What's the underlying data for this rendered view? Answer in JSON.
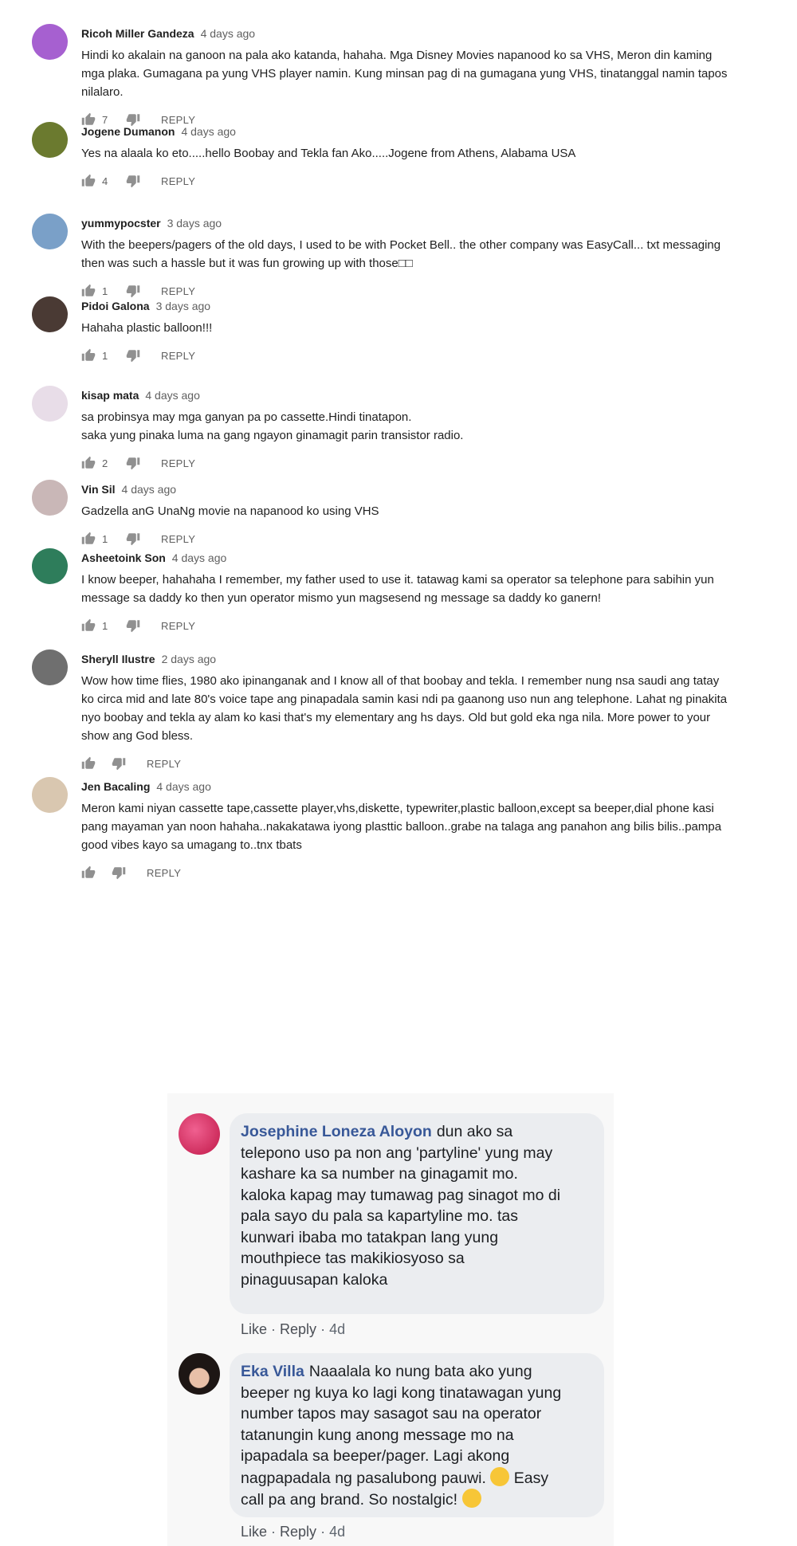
{
  "yt_comments": [
    {
      "author": "Ricoh Miller Gandeza",
      "time": "4 days ago",
      "lines": [
        "Hindi ko akalain na ganoon na pala ako katanda, hahaha. Mga Disney Movies napanood ko sa VHS, Meron din kaming",
        "mga plaka. Gumagana pa yung VHS player namin. Kung minsan  pag di na gumagana yung VHS, tinatanggal namin  tapos",
        "nilalaro."
      ],
      "likes": "7",
      "reply": "REPLY",
      "avatar_color": "#a660d0",
      "avatar_letter": ""
    },
    {
      "author": "Jogene Dumanon",
      "time": "4 days ago",
      "lines": [
        "Yes na alaala ko eto.....hello Boobay and Tekla fan Ako.....Jogene from Athens, Alabama USA"
      ],
      "likes": "4",
      "reply": "REPLY",
      "avatar_color": "#6b7a2f",
      "avatar_letter": ""
    },
    {
      "author": "yummypocster",
      "time": "3 days ago",
      "lines": [
        "With the beepers/pagers of the old days, I used to be with Pocket Bell.. the other company was EasyCall... txt messaging",
        "then was such a hassle but it was fun growing up with those□□"
      ],
      "likes": "1",
      "reply": "REPLY",
      "avatar_color": "#7aa0c8",
      "avatar_letter": ""
    },
    {
      "author": "Pidoi Galona",
      "time": "3 days ago",
      "lines": [
        "Hahaha plastic balloon!!!"
      ],
      "likes": "1",
      "reply": "REPLY",
      "avatar_color": "#4a3a34",
      "avatar_letter": ""
    },
    {
      "author": "kisap mata",
      "time": "4 days ago",
      "lines": [
        "sa probinsya may mga ganyan pa po cassette.Hindi tinatapon.",
        "saka yung pinaka luma na gang ngayon ginamagit parin transistor radio."
      ],
      "likes": "2",
      "reply": "REPLY",
      "avatar_color": "#e8dde8",
      "avatar_letter": ""
    },
    {
      "author": "Vin Sil",
      "time": "4 days ago",
      "lines": [
        "Gadzella anG UnaNg movie na napanood ko using VHS"
      ],
      "likes": "1",
      "reply": "REPLY",
      "avatar_color": "#c9b7b7",
      "avatar_letter": ""
    },
    {
      "author": "Asheetoink Son",
      "time": "4 days ago",
      "lines": [
        "I know beeper, hahahaha I remember, my father used to use it. tatawag kami sa operator sa telephone para sabihin yun",
        "message sa daddy ko then yun operator mismo yun magsesend ng message sa daddy ko ganern!"
      ],
      "likes": "1",
      "reply": "REPLY",
      "avatar_color": "#2e7d5b",
      "avatar_letter": ""
    },
    {
      "author": "Sheryll Ilustre",
      "time": "2 days ago",
      "lines": [
        "Wow how time flies, 1980 ako ipinanganak and I know all of that boobay and tekla. I remember nung nsa saudi ang tatay",
        "ko circa mid and late 80's voice tape ang pinapadala samin kasi ndi pa gaanong uso nun ang telephone. Lahat ng pinakita",
        "nyo boobay and tekla ay alam ko kasi that's my elementary ang hs days. Old but gold eka nga nila. More power to your",
        "show ang God bless."
      ],
      "likes": "",
      "reply": "REPLY",
      "avatar_color": "#6f6f6f",
      "avatar_letter": ""
    },
    {
      "author": "Jen Bacaling",
      "time": "4 days ago",
      "lines": [
        "Meron kami niyan cassette tape,cassette player,vhs,diskette, typewriter,plastic balloon,except sa beeper,dial phone kasi",
        "pang mayaman yan noon hahaha..nakakatawa iyong plasttic balloon..grabe na talaga ang panahon ang bilis bilis..pampa",
        "good vibes kayo sa umagang to..tnx tbats"
      ],
      "likes": "",
      "reply": "REPLY",
      "avatar_color": "#d9c7b0",
      "avatar_letter": ""
    }
  ],
  "fb_comments": [
    {
      "author": "Josephine Loneza Aloyon",
      "lines_first": "dun ako sa",
      "lines": [
        "telepono uso pa non ang 'partyline' yung may",
        "kashare ka sa number na ginagamit mo.",
        "kaloka kapag may tumawag pag sinagot mo di",
        "pala sayo du pala sa kapartyline mo. tas",
        "kunwari ibaba mo tatakpan lang yung",
        "mouthpiece tas makikiosyoso sa",
        "pinaguusapan kaloka"
      ],
      "like": "Like",
      "reply": "Reply",
      "time": "4d",
      "avatar_color": "#d8305a"
    },
    {
      "author": "Eka Villa",
      "lines_first": "Naaalala ko nung bata ako yung",
      "lines": [
        "beeper ng kuya ko lagi kong tinatawagan yung",
        "number tapos may sasagot sau na operator",
        "tatanungin kung anong message mo na",
        "ipapadala sa beeper/pager. Lagi akong",
        "nagpapadala ng pasalubong pauwi.",
        "call pa ang brand. So nostalgic!"
      ],
      "emoji_after_line_5": "Easy",
      "like": "Like",
      "reply": "Reply",
      "time": "4d",
      "avatar_color": "#2a2220"
    }
  ],
  "colors": {
    "fb_name": "#385898",
    "yt_meta": "#606060"
  }
}
